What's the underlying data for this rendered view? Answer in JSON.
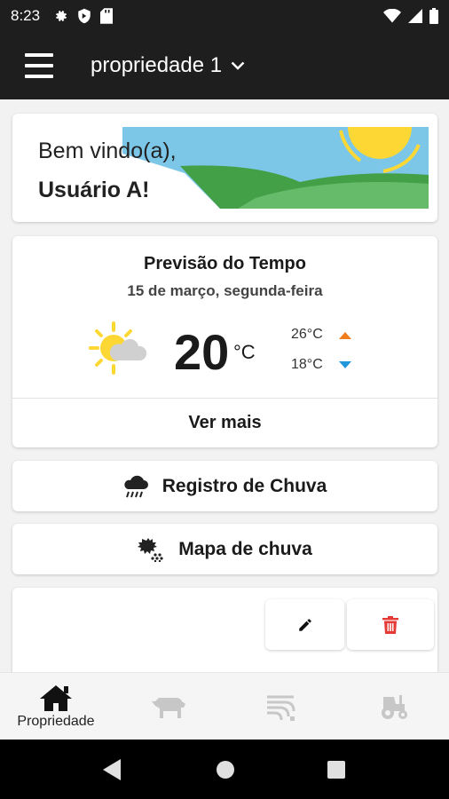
{
  "status_bar": {
    "time": "8:23"
  },
  "app_bar": {
    "property_name": "propriedade 1"
  },
  "welcome": {
    "greeting": "Bem vindo(a),",
    "user_name": "Usuário A!"
  },
  "weather": {
    "title": "Previsão do Tempo",
    "date": "15 de março, segunda-feira",
    "temperature": "20",
    "unit": "°C",
    "max": "26°C",
    "min": "18°C",
    "see_more_label": "Ver mais",
    "icon": "sun-cloud-icon"
  },
  "actions": {
    "rain_record_label": "Registro de Chuva",
    "rain_map_label": "Mapa de chuva"
  },
  "bottom_nav": {
    "items": [
      {
        "label": "Propriedade",
        "icon": "home-icon",
        "active": true
      },
      {
        "label": "",
        "icon": "cattle-icon",
        "active": false
      },
      {
        "label": "",
        "icon": "field-icon",
        "active": false
      },
      {
        "label": "",
        "icon": "tractor-icon",
        "active": false
      }
    ]
  },
  "colors": {
    "app_bar": "#1e1e1e",
    "max_arrow": "#f07c1b",
    "min_arrow": "#2196d9",
    "delete": "#e53935",
    "sky": "#7cc7e8",
    "grass": "#4caf50",
    "sun": "#fdd835"
  }
}
